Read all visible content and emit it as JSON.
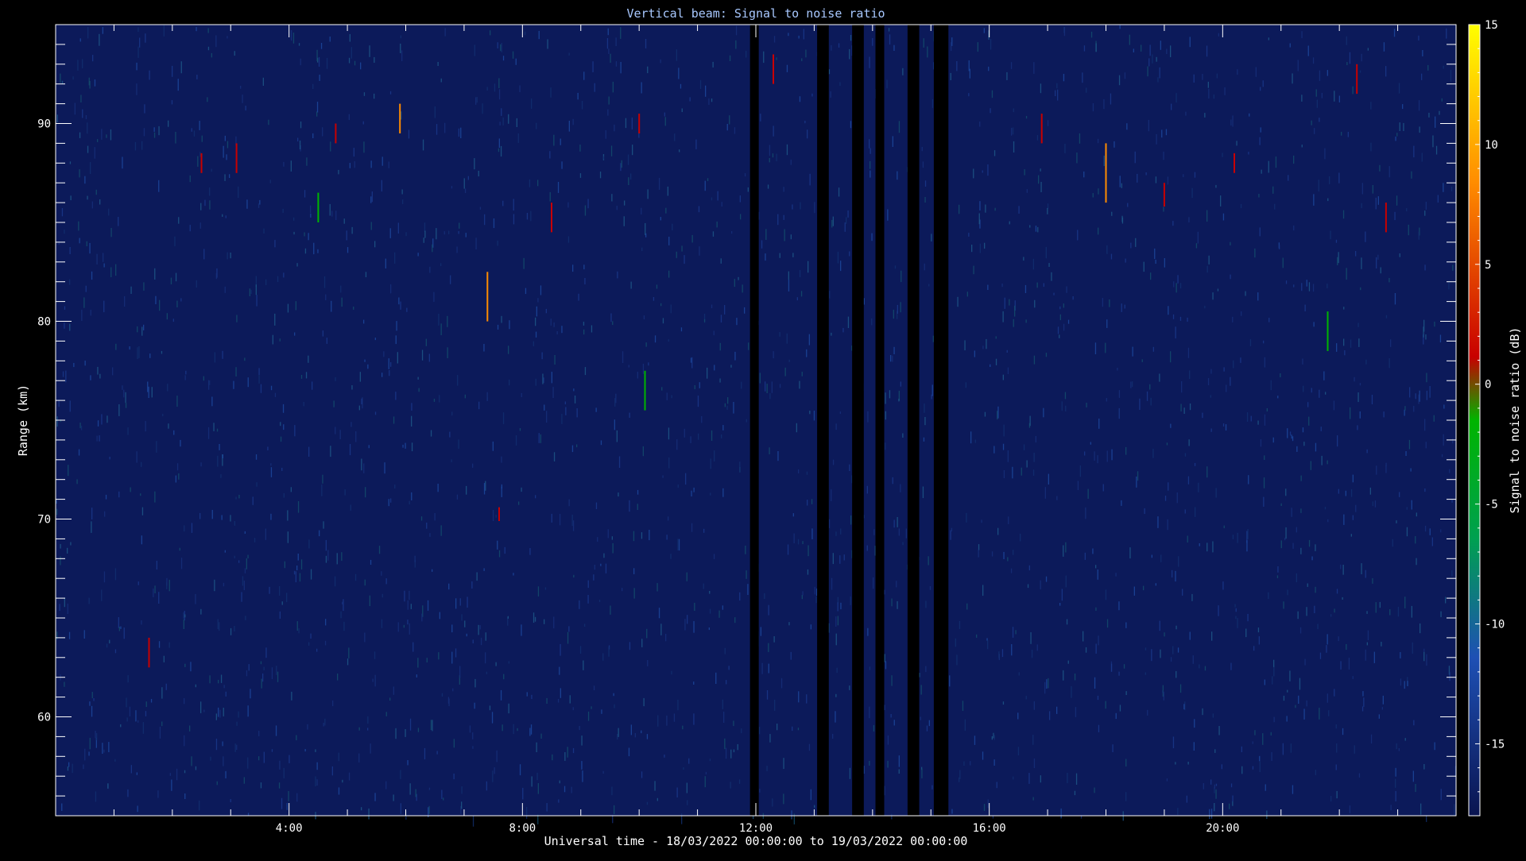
{
  "chart_data": {
    "type": "heatmap",
    "title": "Vertical beam: Signal to noise ratio",
    "xlabel": "Universal time - 18/03/2022 00:00:00 to 19/03/2022 00:00:00",
    "ylabel": "Range (km)",
    "colorbar_label": "Signal to noise ratio (dB)",
    "x_unit": "hours UT",
    "xlim": [
      0,
      24
    ],
    "ylim": [
      55,
      95
    ],
    "zlim": [
      -18,
      15
    ],
    "x_ticks": [
      4,
      8,
      12,
      16,
      20
    ],
    "x_tick_labels": [
      "4:00",
      "8:00",
      "12:00",
      "16:00",
      "20:00"
    ],
    "y_ticks": [
      60,
      70,
      80,
      90
    ],
    "y_tick_labels": [
      "60",
      "70",
      "80",
      "90"
    ],
    "colorbar_ticks": [
      -15,
      -10,
      -5,
      0,
      5,
      10,
      15
    ],
    "colorbar_tick_labels": [
      "-15",
      "-10",
      "-5",
      "0",
      "5",
      "10",
      "15"
    ],
    "background_snr_db": -15,
    "data_gaps_hours": [
      [
        11.9,
        12.05
      ],
      [
        13.05,
        13.25
      ],
      [
        13.65,
        13.85
      ],
      [
        14.05,
        14.2
      ],
      [
        14.6,
        14.8
      ],
      [
        15.05,
        15.3
      ]
    ],
    "echoes": [
      {
        "t": 1.6,
        "r_min": 62.5,
        "r_max": 64,
        "snr": 3
      },
      {
        "t": 2.5,
        "r_min": 87.5,
        "r_max": 88.5,
        "snr": 2
      },
      {
        "t": 3.1,
        "r_min": 87.5,
        "r_max": 89,
        "snr": 4
      },
      {
        "t": 4.5,
        "r_min": 85,
        "r_max": 86.5,
        "snr": 1
      },
      {
        "t": 4.8,
        "r_min": 89,
        "r_max": 90,
        "snr": 2
      },
      {
        "t": 5.9,
        "r_min": 89.5,
        "r_max": 91,
        "snr": 9
      },
      {
        "t": 7.4,
        "r_min": 80,
        "r_max": 82.5,
        "snr": 8
      },
      {
        "t": 7.6,
        "r_min": 69.9,
        "r_max": 70.6,
        "snr": 2
      },
      {
        "t": 8.5,
        "r_min": 84.5,
        "r_max": 86,
        "snr": 2
      },
      {
        "t": 10.0,
        "r_min": 89.5,
        "r_max": 90.5,
        "snr": 3
      },
      {
        "t": 10.1,
        "r_min": 75.5,
        "r_max": 77.5,
        "snr": 1
      },
      {
        "t": 12.3,
        "r_min": 92,
        "r_max": 93.5,
        "snr": 3
      },
      {
        "t": 16.9,
        "r_min": 89,
        "r_max": 90.5,
        "snr": 3
      },
      {
        "t": 18.0,
        "r_min": 86,
        "r_max": 89,
        "snr": 12
      },
      {
        "t": 19.0,
        "r_min": 85.8,
        "r_max": 87,
        "snr": 2
      },
      {
        "t": 20.2,
        "r_min": 87.5,
        "r_max": 88.5,
        "snr": 3
      },
      {
        "t": 21.8,
        "r_min": 78.5,
        "r_max": 80.5,
        "snr": 1
      },
      {
        "t": 22.3,
        "r_min": 91.5,
        "r_max": 93,
        "snr": 2
      },
      {
        "t": 22.8,
        "r_min": 84.5,
        "r_max": 86,
        "snr": 2
      }
    ],
    "colormap": [
      "#0a1450",
      "#1e50b4",
      "#00a050",
      "#00b400",
      "#c80000",
      "#ff8c00",
      "#ffff00"
    ]
  }
}
